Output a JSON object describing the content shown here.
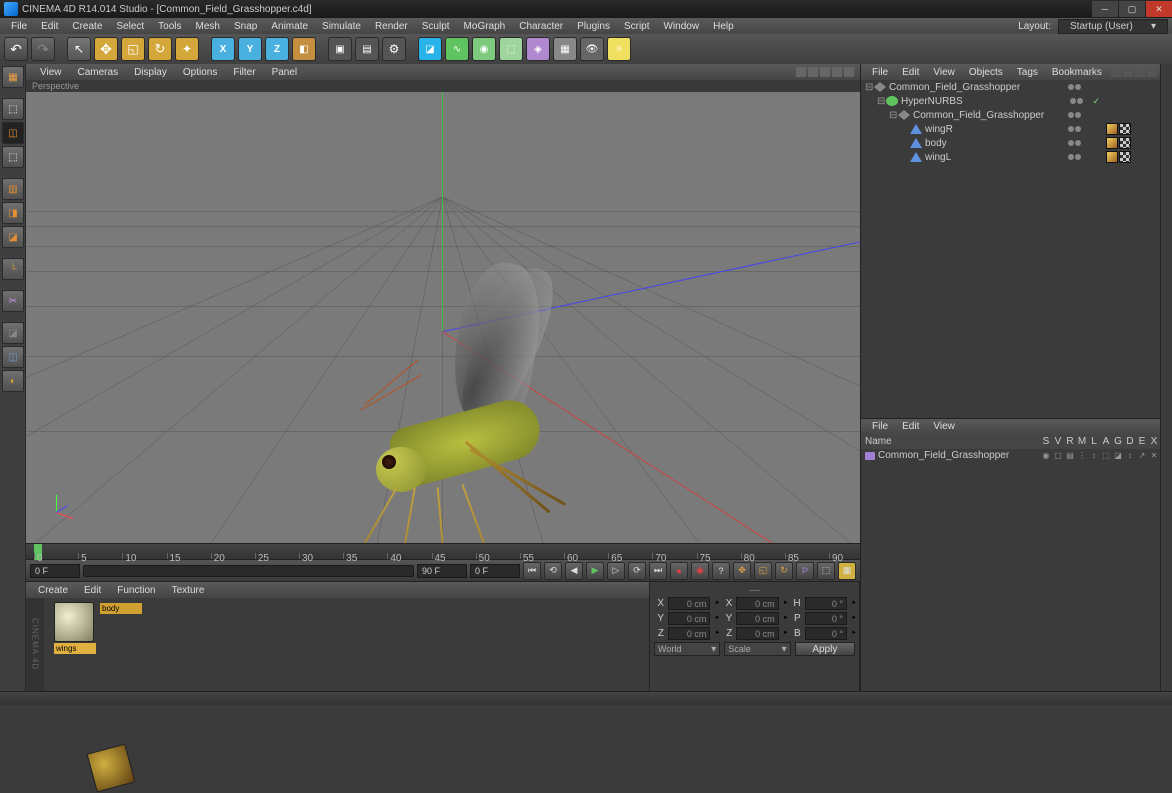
{
  "title": "CINEMA 4D R14.014 Studio - [Common_Field_Grasshopper.c4d]",
  "menu": [
    "File",
    "Edit",
    "Create",
    "Select",
    "Tools",
    "Mesh",
    "Snap",
    "Animate",
    "Simulate",
    "Render",
    "Sculpt",
    "MoGraph",
    "Character",
    "Plugins",
    "Script",
    "Window",
    "Help"
  ],
  "layout": {
    "label": "Layout:",
    "value": "Startup (User)"
  },
  "viewMenu": [
    "View",
    "Cameras",
    "Display",
    "Options",
    "Filter",
    "Panel"
  ],
  "viewLabel": "Perspective",
  "timeline": {
    "ticks": [
      0,
      5,
      10,
      15,
      20,
      25,
      30,
      35,
      40,
      45,
      50,
      55,
      60,
      65,
      70,
      75,
      80,
      85,
      90
    ],
    "frameStart": "0 F",
    "frameEnd": "90 F",
    "frameStart2": "0 F",
    "frameEnd2": "90 F"
  },
  "materials": {
    "menu": [
      "Create",
      "Edit",
      "Function",
      "Texture"
    ],
    "items": [
      {
        "name": "wings",
        "cls": "wings",
        "sel": true
      },
      {
        "name": "body",
        "cls": "body",
        "sel": false
      }
    ],
    "brand": "CINEMA 4D"
  },
  "coord": {
    "rows": [
      {
        "l": "X",
        "v": "0 cm",
        "l2": "X",
        "v2": "0 cm",
        "l3": "H",
        "v3": "0 °"
      },
      {
        "l": "Y",
        "v": "0 cm",
        "l2": "Y",
        "v2": "0 cm",
        "l3": "P",
        "v3": "0 °"
      },
      {
        "l": "Z",
        "v": "0 cm",
        "l2": "Z",
        "v2": "0 cm",
        "l3": "B",
        "v3": "0 °"
      }
    ],
    "mode1": "World",
    "mode2": "Scale",
    "apply": "Apply"
  },
  "objPanel": {
    "menu": [
      "File",
      "Edit",
      "View",
      "Objects",
      "Tags",
      "Bookmarks"
    ],
    "tree": [
      {
        "indent": 0,
        "toggle": "⊟",
        "icon": "oi-null",
        "name": "Common_Field_Grasshopper",
        "dots": true,
        "chk": false,
        "tags": []
      },
      {
        "indent": 1,
        "toggle": "⊟",
        "icon": "oi-hn",
        "name": "HyperNURBS",
        "dots": true,
        "chk": true,
        "tags": []
      },
      {
        "indent": 2,
        "toggle": "⊟",
        "icon": "oi-null",
        "name": "Common_Field_Grasshopper",
        "dots": true,
        "chk": false,
        "tags": []
      },
      {
        "indent": 3,
        "toggle": "",
        "icon": "oi-poly",
        "name": "wingR",
        "dots": true,
        "chk": false,
        "tags": [
          "ph",
          "tex"
        ]
      },
      {
        "indent": 3,
        "toggle": "",
        "icon": "oi-poly",
        "name": "body",
        "dots": true,
        "chk": false,
        "tags": [
          "ph",
          "tex"
        ]
      },
      {
        "indent": 3,
        "toggle": "",
        "icon": "oi-poly",
        "name": "wingL",
        "dots": true,
        "chk": false,
        "tags": [
          "ph",
          "tex"
        ]
      }
    ]
  },
  "attrPanel": {
    "menu": [
      "File",
      "Edit",
      "View"
    ],
    "nameHdr": "Name",
    "cols": [
      "S",
      "V",
      "R",
      "M",
      "L",
      "A",
      "G",
      "D",
      "E",
      "X"
    ],
    "take": "Common_Field_Grasshopper"
  }
}
